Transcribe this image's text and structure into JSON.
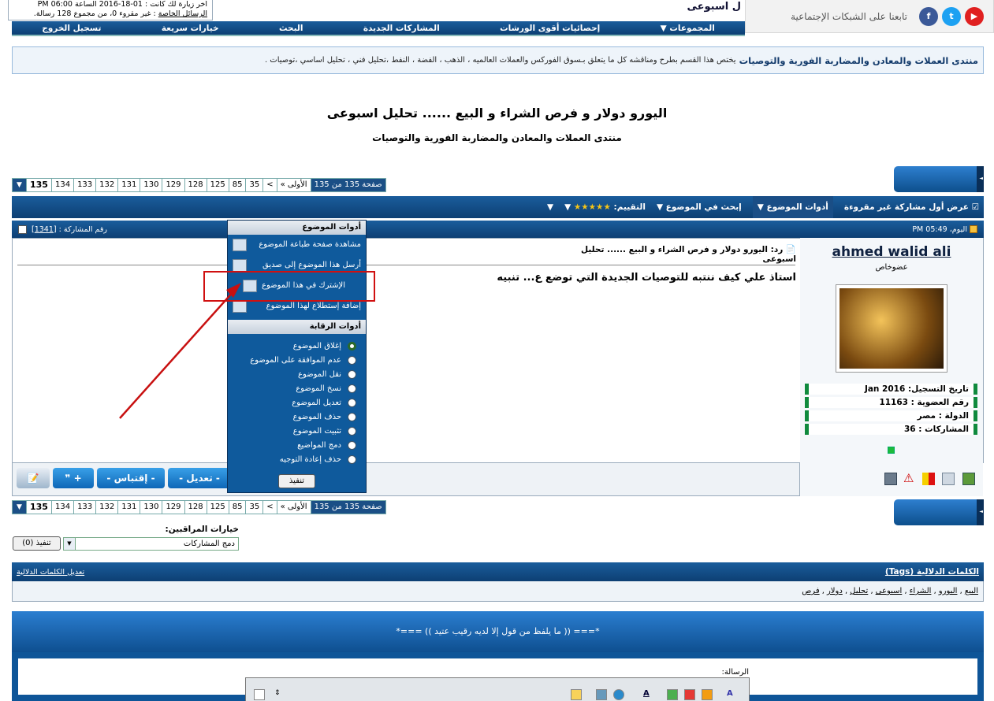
{
  "top": {
    "info_line1": "آخر زيارة لك كانت : 01-18-2016 الساعة 06:00 PM",
    "private_msgs_link": "الرسائل الخاصة",
    "private_msgs_text": ": غير مقروء 0، من مجموع 128 رسالة.",
    "title_fragment": "ل اسبوعى",
    "social_label": "تابعنا على الشبكات الإجتماعية"
  },
  "nav": [
    "المجموعات",
    "إحصائيات أقوى الورشات",
    "المشاركات الجديدة",
    "البحث",
    "خيارات سريعة",
    "تسجيل الخروج"
  ],
  "forum": {
    "name": "منتدى العملات والمعادن والمضاربة الفورية والتوصيات",
    "desc": "يختص هذا القسم بطرح ومناقشه كل ما يتعلق بـسوق الفوركس والعملات العالميه ، الذهب ، الفضة ، النفط ،تحليل فني ، تحليل اساسي ،توصيات ."
  },
  "thread": {
    "title": "اليورو دولار و فرص الشراء و البيع ...... تحليل اسبوعى",
    "forum_name": "منتدى العملات والمعادن والمضاربة الفورية والتوصيات"
  },
  "pager": {
    "label": "صفحة 135 من 135",
    "first": "« الأولى",
    "prev": "<",
    "pages": [
      "35",
      "85",
      "125",
      "128",
      "129",
      "130",
      "131",
      "132",
      "133",
      "134",
      "135"
    ]
  },
  "postbar": {
    "first_unread": "عرض أول مشاركة غير مقروءة",
    "tools": "أدوات الموضوع",
    "search": "إبحث في الموضوع",
    "rating": "التقييم:",
    "stars": "★★★★★"
  },
  "post": {
    "date": "اليوم، 05:49 PM",
    "number_label": "رقم المشاركة :",
    "number": "[1341]",
    "title": "رد: اليورو دولار و فرص الشراء و البيع ...... تحليل اسبوعى",
    "body": "استاذ علي كيف ننتبه للتوصيات الجديدة التي توضع ع... تنبيه"
  },
  "user": {
    "name": "ahmed walid ali",
    "title": "عضوخاص",
    "reg_date": "تاريخ التسجيل: Jan 2016",
    "member_no": "رقم العضوية : 11163",
    "country": "الدولة : مصر",
    "posts": "المشاركات : 36"
  },
  "buttons": {
    "multiquote": "+ ❞",
    "quote": "- إقتباس -",
    "edit": "- تعديل -"
  },
  "menu": {
    "head_tools": "أدوات الموضوع",
    "items": [
      "مشاهدة صفحة طباعة الموضوع",
      "أرسل هذا الموضوع إلى صديق",
      "الإشترك في هذا الموضوع",
      "إضافة إستطلاع لهذا الموضوع"
    ],
    "head_mod": "أدوات الرقابة",
    "mod_items": [
      "إغلاق الموضوع",
      "عدم الموافقة على الموضوع",
      "نقل الموضوع",
      "نسخ الموضوع",
      "تعديل الموضوع",
      "حذف الموضوع",
      "تثبيت الموضوع",
      "دمج المواضيع",
      "حذف إعادة التوجيه"
    ],
    "submit": "تنفيذ"
  },
  "mod": {
    "label": "خيارات المراقبين:",
    "selected": "دمج المشاركات",
    "go": "(0) تنفيذ"
  },
  "tags": {
    "title": "الكلمات الدلالية (Tags)",
    "edit": "تعديل الكلمات الدلالية",
    "list": [
      "البيع",
      "اليورو",
      "الشراء",
      "اسبوعى",
      "تحليل",
      "دولار",
      "فرص"
    ]
  },
  "quick": {
    "quote": "*=== (( ما يلفظ من قول إلا لديه رقيب عتيد )) ===*",
    "msg_label": "الرسالة:"
  },
  "colors": {
    "header": "#0d3f73",
    "accent": "#1a5d9c",
    "highlight": "#d01010"
  }
}
